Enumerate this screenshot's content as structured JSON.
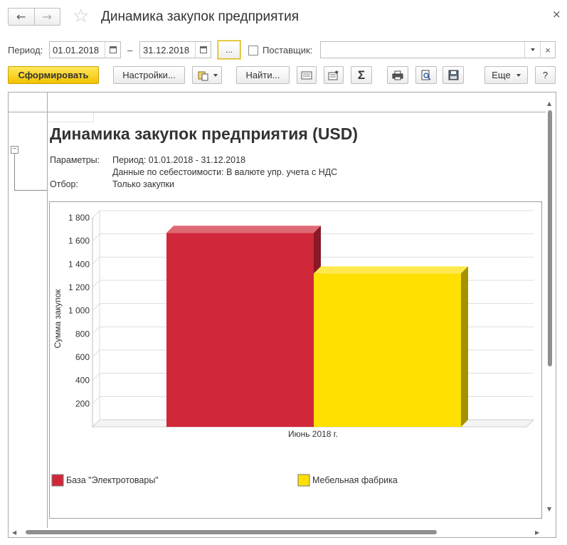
{
  "window": {
    "title": "Динамика закупок предприятия",
    "back_icon": "←",
    "forward_icon": "→",
    "star_icon": "☆",
    "close_icon": "×"
  },
  "period": {
    "label": "Период:",
    "from": "01.01.2018",
    "dash": "–",
    "to": "31.12.2018",
    "more_label": "...",
    "supplier_label": "Поставщик:",
    "supplier_value": "",
    "clear_icon": "×"
  },
  "toolbar": {
    "generate_label": "Сформировать",
    "settings_label": "Настройки...",
    "find_label": "Найти...",
    "sigma_label": "Σ",
    "more_label": "Еще",
    "help_label": "?"
  },
  "report": {
    "title": "Динамика закупок предприятия (USD)",
    "params_label": "Параметры:",
    "params_line1": "Период: 01.01.2018 - 31.12.2018",
    "params_line2": "Данные по себестоимости: В валюте упр. учета с НДС",
    "filter_label": "Отбор:",
    "filter_value": "Только закупки",
    "collapse_icon": "−"
  },
  "chart_data": {
    "type": "bar",
    "categories": [
      "Июнь 2018 г."
    ],
    "series": [
      {
        "name": "База \"Электротовары\"",
        "values": [
          1670
        ],
        "color": "#d0283a"
      },
      {
        "name": "Мебельная фабрика",
        "values": [
          1320
        ],
        "color": "#ffe000"
      }
    ],
    "ylabel": "Сумма закупок",
    "ylim": [
      0,
      1800
    ],
    "yticks": [
      "200",
      "400",
      "600",
      "800",
      "1 000",
      "1 200",
      "1 400",
      "1 600",
      "1 800"
    ],
    "grid": true,
    "legend_position": "bottom",
    "style": "3d"
  }
}
